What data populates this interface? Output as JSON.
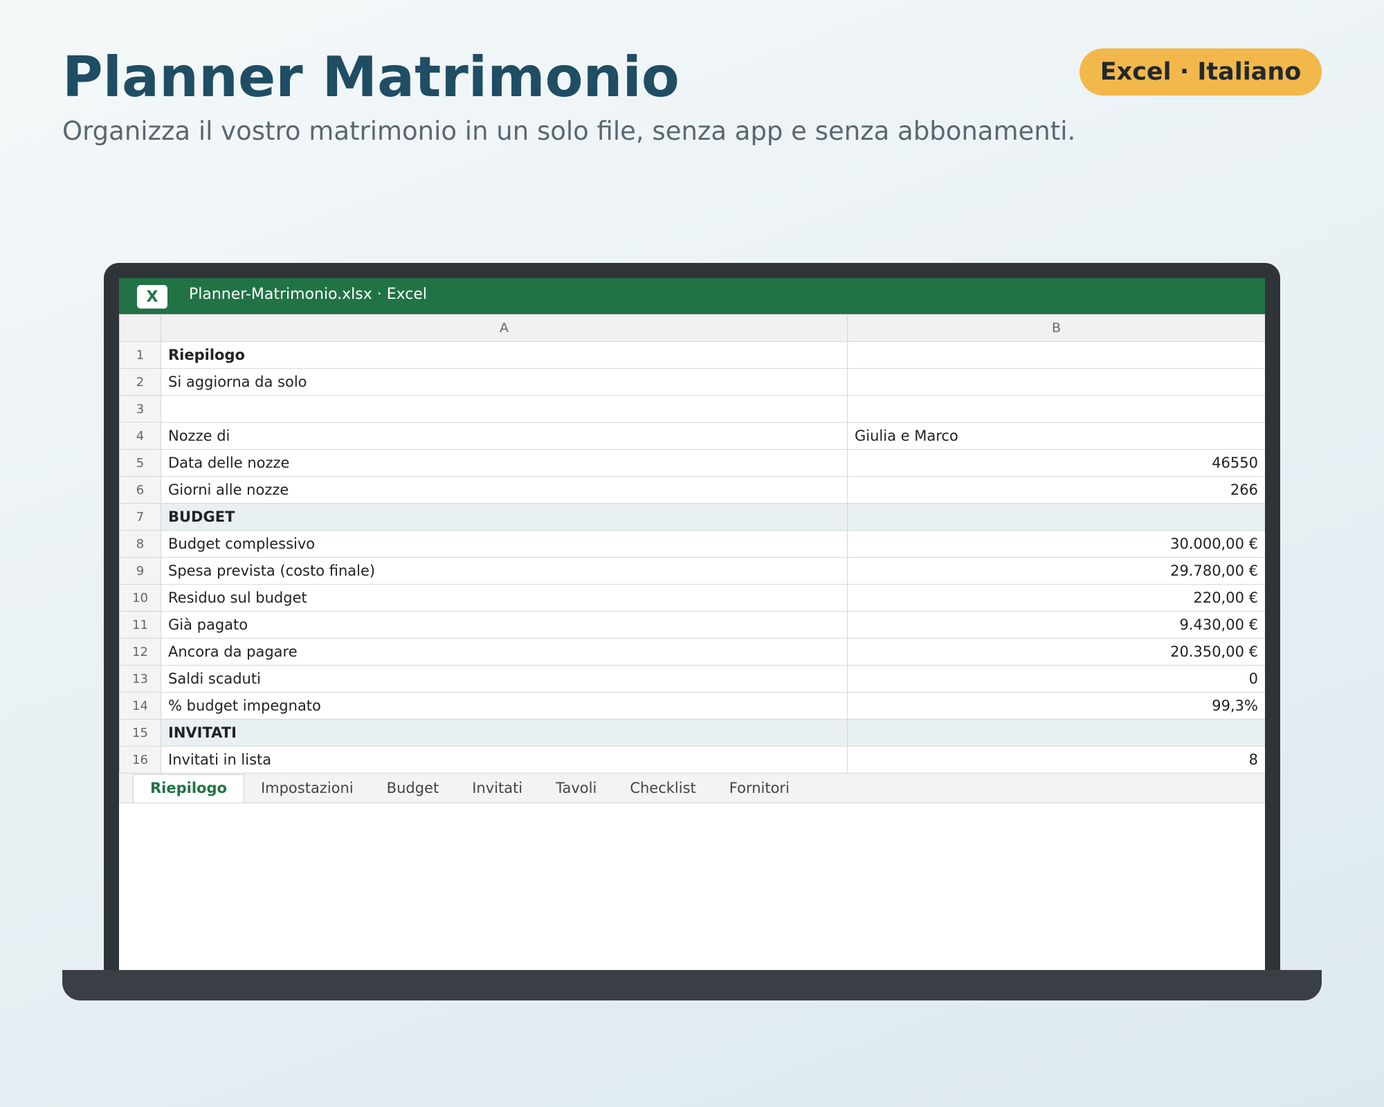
{
  "header": {
    "title": "Planner Matrimonio",
    "subtitle": "Organizza il vostro matrimonio in un solo file, senza app e senza abbonamenti.",
    "badge": "Excel · Italiano"
  },
  "window": {
    "icon_label": "X",
    "title": "Planner-Matrimonio.xlsx · Excel"
  },
  "columns": [
    "A",
    "B"
  ],
  "rows": [
    {
      "n": "1",
      "a": "Riepilogo",
      "b": "",
      "style": "bold"
    },
    {
      "n": "2",
      "a": "Si aggiorna da solo",
      "b": "",
      "style": "muted"
    },
    {
      "n": "3",
      "a": "",
      "b": "",
      "style": ""
    },
    {
      "n": "4",
      "a": "Nozze di",
      "b": "Giulia e Marco",
      "style": "text"
    },
    {
      "n": "5",
      "a": "Data delle nozze",
      "b": "46550",
      "style": ""
    },
    {
      "n": "6",
      "a": "Giorni alle nozze",
      "b": "266",
      "style": ""
    },
    {
      "n": "7",
      "a": "BUDGET",
      "b": "",
      "style": "section"
    },
    {
      "n": "8",
      "a": "Budget complessivo",
      "b": "30.000,00 €",
      "style": ""
    },
    {
      "n": "9",
      "a": "Spesa prevista (costo finale)",
      "b": "29.780,00 €",
      "style": ""
    },
    {
      "n": "10",
      "a": "Residuo sul budget",
      "b": "220,00 €",
      "style": ""
    },
    {
      "n": "11",
      "a": "Già pagato",
      "b": "9.430,00 €",
      "style": ""
    },
    {
      "n": "12",
      "a": "Ancora da pagare",
      "b": "20.350,00 €",
      "style": ""
    },
    {
      "n": "13",
      "a": "Saldi scaduti",
      "b": "0",
      "style": ""
    },
    {
      "n": "14",
      "a": "% budget impegnato",
      "b": "99,3%",
      "style": ""
    },
    {
      "n": "15",
      "a": "INVITATI",
      "b": "",
      "style": "section"
    },
    {
      "n": "16",
      "a": "Invitati in lista",
      "b": "8",
      "style": ""
    }
  ],
  "sheet_tabs": [
    {
      "label": "Riepilogo",
      "active": true
    },
    {
      "label": "Impostazioni",
      "active": false
    },
    {
      "label": "Budget",
      "active": false
    },
    {
      "label": "Invitati",
      "active": false
    },
    {
      "label": "Tavoli",
      "active": false
    },
    {
      "label": "Checklist",
      "active": false
    },
    {
      "label": "Fornitori",
      "active": false
    }
  ],
  "colors": {
    "excel_green": "#217346",
    "title_blue": "#1f4d63",
    "badge_yellow": "#f2b84b"
  }
}
